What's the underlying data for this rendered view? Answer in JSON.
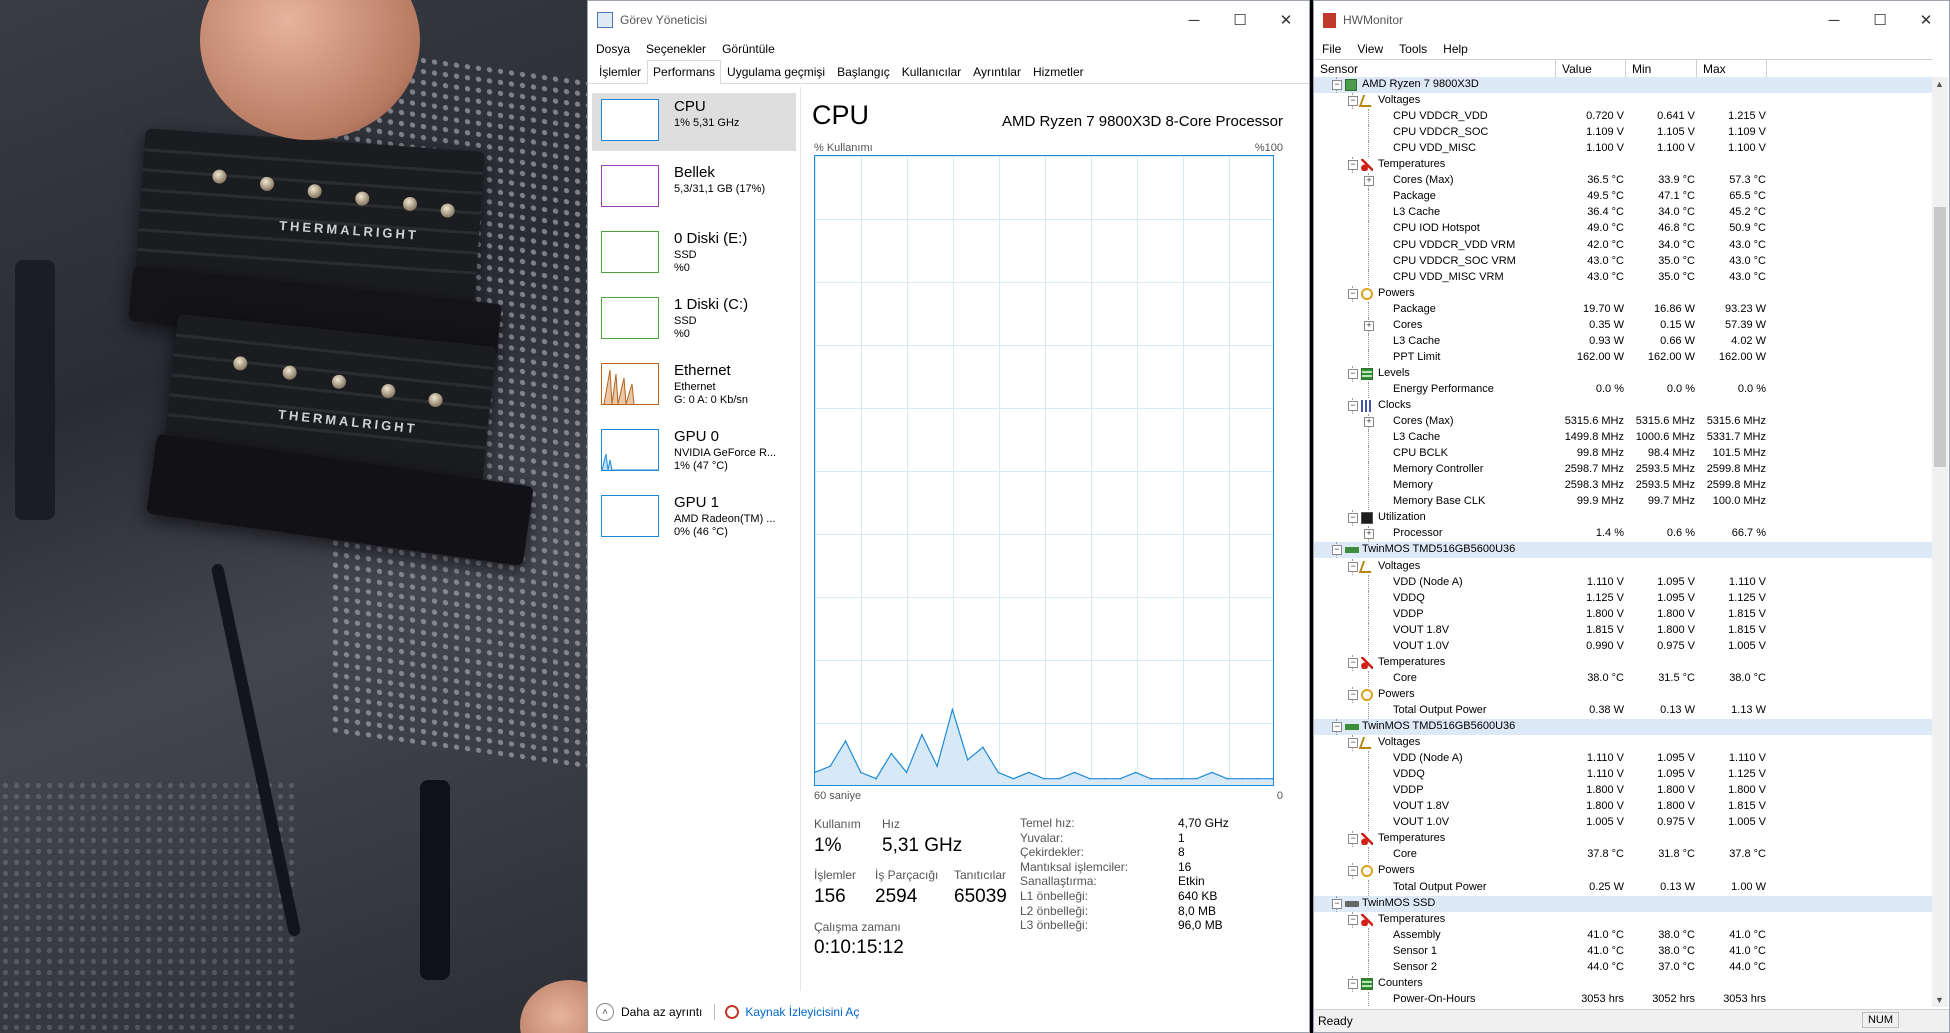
{
  "task_manager": {
    "title": "Görev Yöneticisi",
    "menu": [
      "Dosya",
      "Seçenekler",
      "Görüntüle"
    ],
    "tabs": [
      "İşlemler",
      "Performans",
      "Uygulama geçmişi",
      "Başlangıç",
      "Kullanıcılar",
      "Ayrıntılar",
      "Hizmetler"
    ],
    "active_tab": "Performans",
    "sidebar": [
      {
        "name": "CPU",
        "line1": "1% 5,31 GHz",
        "line2": "",
        "color": "#1e8ad6"
      },
      {
        "name": "Bellek",
        "line1": "5,3/31,1 GB (17%)",
        "line2": "",
        "color": "#9b3fb5"
      },
      {
        "name": "0 Diski (E:)",
        "line1": "SSD",
        "line2": "%0",
        "color": "#4aa63a"
      },
      {
        "name": "1 Diski (C:)",
        "line1": "SSD",
        "line2": "%0",
        "color": "#4aa63a"
      },
      {
        "name": "Ethernet",
        "line1": "Ethernet",
        "line2": "G: 0 A: 0 Kb/sn",
        "color": "#b8621b"
      },
      {
        "name": "GPU 0",
        "line1": "NVIDIA GeForce R...",
        "line2": "1% (47 °C)",
        "color": "#1e8ad6"
      },
      {
        "name": "GPU 1",
        "line1": "AMD Radeon(TM) ...",
        "line2": "0% (46 °C)",
        "color": "#1e8ad6"
      }
    ],
    "main": {
      "heading": "CPU",
      "processor": "AMD Ryzen 7 9800X3D 8-Core Processor",
      "y_label": "% Kullanımı",
      "y_max": "%100",
      "x_left": "60 saniye",
      "x_right": "0",
      "usage_label": "Kullanım",
      "usage_value": "1%",
      "speed_label": "Hız",
      "speed_value": "5,31 GHz",
      "processes_label": "İşlemler",
      "processes_value": "156",
      "threads_label": "İş Parçacığı",
      "threads_value": "2594",
      "handles_label": "Tanıtıcılar",
      "handles_value": "65039",
      "uptime_label": "Çalışma zamanı",
      "uptime_value": "0:10:15:12",
      "specs": [
        {
          "label": "Temel hız:",
          "value": "4,70 GHz"
        },
        {
          "label": "Yuvalar:",
          "value": "1"
        },
        {
          "label": "Çekirdekler:",
          "value": "8"
        },
        {
          "label": "Mantıksal işlemciler:",
          "value": "16"
        },
        {
          "label": "Sanallaştırma:",
          "value": "Etkin"
        },
        {
          "label": "L1 önbelleği:",
          "value": "640 KB"
        },
        {
          "label": "L2 önbelleği:",
          "value": "8,0 MB"
        },
        {
          "label": "L3 önbelleği:",
          "value": "96,0 MB"
        }
      ]
    },
    "footer": {
      "less_details": "Daha az ayrıntı",
      "resource_monitor": "Kaynak İzleyicisini Aç"
    }
  },
  "chart_data": {
    "type": "area",
    "ylabel": "% Kullanımı",
    "ylim": [
      0,
      100
    ],
    "x": [
      60,
      58,
      56,
      54,
      52,
      50,
      48,
      46,
      44,
      42,
      40,
      38,
      36,
      34,
      32,
      30,
      28,
      26,
      24,
      22,
      20,
      18,
      16,
      14,
      12,
      10,
      8,
      6,
      4,
      2,
      0
    ],
    "values": [
      2,
      3,
      7,
      2,
      1,
      5,
      2,
      8,
      3,
      12,
      4,
      6,
      2,
      1,
      2,
      1,
      1,
      2,
      1,
      1,
      1,
      2,
      1,
      1,
      1,
      1,
      2,
      1,
      1,
      1,
      1
    ]
  },
  "hwmonitor": {
    "title": "HWMonitor",
    "menu": [
      "File",
      "View",
      "Tools",
      "Help"
    ],
    "columns": [
      "Sensor",
      "Value",
      "Min",
      "Max"
    ],
    "status": "Ready",
    "num": "NUM",
    "rows": [
      {
        "lvl": 0,
        "icon": "chip-icon",
        "label": "AMD Ryzen 7 9800X3D",
        "v": "",
        "mn": "",
        "mx": "",
        "grp": true,
        "pm": "-"
      },
      {
        "lvl": 1,
        "icon": "voltage-icon",
        "label": "Voltages",
        "v": "",
        "mn": "",
        "mx": "",
        "pm": "-"
      },
      {
        "lvl": 2,
        "label": "CPU VDDCR_VDD",
        "v": "0.720 V",
        "mn": "0.641 V",
        "mx": "1.215 V"
      },
      {
        "lvl": 2,
        "label": "CPU VDDCR_SOC",
        "v": "1.109 V",
        "mn": "1.105 V",
        "mx": "1.109 V"
      },
      {
        "lvl": 2,
        "label": "CPU VDD_MISC",
        "v": "1.100 V",
        "mn": "1.100 V",
        "mx": "1.100 V"
      },
      {
        "lvl": 1,
        "icon": "temperature-icon",
        "label": "Temperatures",
        "v": "",
        "mn": "",
        "mx": "",
        "pm": "-"
      },
      {
        "lvl": 2,
        "label": "Cores (Max)",
        "v": "36.5 °C",
        "mn": "33.9 °C",
        "mx": "57.3 °C",
        "pm": "+"
      },
      {
        "lvl": 2,
        "label": "Package",
        "v": "49.5 °C",
        "mn": "47.1 °C",
        "mx": "65.5 °C"
      },
      {
        "lvl": 2,
        "label": "L3 Cache",
        "v": "36.4 °C",
        "mn": "34.0 °C",
        "mx": "45.2 °C"
      },
      {
        "lvl": 2,
        "label": "CPU IOD Hotspot",
        "v": "49.0 °C",
        "mn": "46.8 °C",
        "mx": "50.9 °C"
      },
      {
        "lvl": 2,
        "label": "CPU VDDCR_VDD VRM",
        "v": "42.0 °C",
        "mn": "34.0 °C",
        "mx": "43.0 °C"
      },
      {
        "lvl": 2,
        "label": "CPU VDDCR_SOC VRM",
        "v": "43.0 °C",
        "mn": "35.0 °C",
        "mx": "43.0 °C"
      },
      {
        "lvl": 2,
        "label": "CPU VDD_MISC VRM",
        "v": "43.0 °C",
        "mn": "35.0 °C",
        "mx": "43.0 °C"
      },
      {
        "lvl": 1,
        "icon": "power-icon",
        "label": "Powers",
        "v": "",
        "mn": "",
        "mx": "",
        "pm": "-"
      },
      {
        "lvl": 2,
        "label": "Package",
        "v": "19.70 W",
        "mn": "16.86 W",
        "mx": "93.23 W"
      },
      {
        "lvl": 2,
        "label": "Cores",
        "v": "0.35 W",
        "mn": "0.15 W",
        "mx": "57.39 W",
        "pm": "+"
      },
      {
        "lvl": 2,
        "label": "L3 Cache",
        "v": "0.93 W",
        "mn": "0.66 W",
        "mx": "4.02 W"
      },
      {
        "lvl": 2,
        "label": "PPT Limit",
        "v": "162.00 W",
        "mn": "162.00 W",
        "mx": "162.00 W"
      },
      {
        "lvl": 1,
        "icon": "levels-icon",
        "label": "Levels",
        "v": "",
        "mn": "",
        "mx": "",
        "pm": "-"
      },
      {
        "lvl": 2,
        "label": "Energy Performance",
        "v": "0.0 %",
        "mn": "0.0 %",
        "mx": "0.0 %"
      },
      {
        "lvl": 1,
        "icon": "clock-icon",
        "label": "Clocks",
        "v": "",
        "mn": "",
        "mx": "",
        "pm": "-"
      },
      {
        "lvl": 2,
        "label": "Cores (Max)",
        "v": "5315.6 MHz",
        "mn": "5315.6 MHz",
        "mx": "5315.6 MHz",
        "pm": "+"
      },
      {
        "lvl": 2,
        "label": "L3 Cache",
        "v": "1499.8 MHz",
        "mn": "1000.6 MHz",
        "mx": "5331.7 MHz"
      },
      {
        "lvl": 2,
        "label": "CPU BCLK",
        "v": "99.8 MHz",
        "mn": "98.4 MHz",
        "mx": "101.5 MHz"
      },
      {
        "lvl": 2,
        "label": "Memory Controller",
        "v": "2598.7 MHz",
        "mn": "2593.5 MHz",
        "mx": "2599.8 MHz"
      },
      {
        "lvl": 2,
        "label": "Memory",
        "v": "2598.3 MHz",
        "mn": "2593.5 MHz",
        "mx": "2599.8 MHz"
      },
      {
        "lvl": 2,
        "label": "Memory Base CLK",
        "v": "99.9 MHz",
        "mn": "99.7 MHz",
        "mx": "100.0 MHz"
      },
      {
        "lvl": 1,
        "icon": "utilization-icon",
        "label": "Utilization",
        "v": "",
        "mn": "",
        "mx": "",
        "pm": "-"
      },
      {
        "lvl": 2,
        "label": "Processor",
        "v": "1.4 %",
        "mn": "0.6 %",
        "mx": "66.7 %",
        "pm": "+"
      },
      {
        "lvl": 0,
        "icon": "ram-icon",
        "label": "TwinMOS TMD516GB5600U36",
        "v": "",
        "mn": "",
        "mx": "",
        "grp": true,
        "pm": "-"
      },
      {
        "lvl": 1,
        "icon": "voltage-icon",
        "label": "Voltages",
        "v": "",
        "mn": "",
        "mx": "",
        "pm": "-"
      },
      {
        "lvl": 2,
        "label": "VDD (Node A)",
        "v": "1.110 V",
        "mn": "1.095 V",
        "mx": "1.110 V"
      },
      {
        "lvl": 2,
        "label": "VDDQ",
        "v": "1.125 V",
        "mn": "1.095 V",
        "mx": "1.125 V"
      },
      {
        "lvl": 2,
        "label": "VDDP",
        "v": "1.800 V",
        "mn": "1.800 V",
        "mx": "1.815 V"
      },
      {
        "lvl": 2,
        "label": "VOUT 1.8V",
        "v": "1.815 V",
        "mn": "1.800 V",
        "mx": "1.815 V"
      },
      {
        "lvl": 2,
        "label": "VOUT 1.0V",
        "v": "0.990 V",
        "mn": "0.975 V",
        "mx": "1.005 V"
      },
      {
        "lvl": 1,
        "icon": "temperature-icon",
        "label": "Temperatures",
        "v": "",
        "mn": "",
        "mx": "",
        "pm": "-"
      },
      {
        "lvl": 2,
        "label": "Core",
        "v": "38.0 °C",
        "mn": "31.5 °C",
        "mx": "38.0 °C"
      },
      {
        "lvl": 1,
        "icon": "power-icon",
        "label": "Powers",
        "v": "",
        "mn": "",
        "mx": "",
        "pm": "-"
      },
      {
        "lvl": 2,
        "label": "Total Output Power",
        "v": "0.38 W",
        "mn": "0.13 W",
        "mx": "1.13 W"
      },
      {
        "lvl": 0,
        "icon": "ram-icon",
        "label": "TwinMOS TMD516GB5600U36",
        "v": "",
        "mn": "",
        "mx": "",
        "grp": true,
        "pm": "-"
      },
      {
        "lvl": 1,
        "icon": "voltage-icon",
        "label": "Voltages",
        "v": "",
        "mn": "",
        "mx": "",
        "pm": "-"
      },
      {
        "lvl": 2,
        "label": "VDD (Node A)",
        "v": "1.110 V",
        "mn": "1.095 V",
        "mx": "1.110 V"
      },
      {
        "lvl": 2,
        "label": "VDDQ",
        "v": "1.110 V",
        "mn": "1.095 V",
        "mx": "1.125 V"
      },
      {
        "lvl": 2,
        "label": "VDDP",
        "v": "1.800 V",
        "mn": "1.800 V",
        "mx": "1.800 V"
      },
      {
        "lvl": 2,
        "label": "VOUT 1.8V",
        "v": "1.800 V",
        "mn": "1.800 V",
        "mx": "1.815 V"
      },
      {
        "lvl": 2,
        "label": "VOUT 1.0V",
        "v": "1.005 V",
        "mn": "0.975 V",
        "mx": "1.005 V"
      },
      {
        "lvl": 1,
        "icon": "temperature-icon",
        "label": "Temperatures",
        "v": "",
        "mn": "",
        "mx": "",
        "pm": "-"
      },
      {
        "lvl": 2,
        "label": "Core",
        "v": "37.8 °C",
        "mn": "31.8 °C",
        "mx": "37.8 °C"
      },
      {
        "lvl": 1,
        "icon": "power-icon",
        "label": "Powers",
        "v": "",
        "mn": "",
        "mx": "",
        "pm": "-"
      },
      {
        "lvl": 2,
        "label": "Total Output Power",
        "v": "0.25 W",
        "mn": "0.13 W",
        "mx": "1.00 W"
      },
      {
        "lvl": 0,
        "icon": "ssd-icon",
        "label": "TwinMOS SSD",
        "v": "",
        "mn": "",
        "mx": "",
        "grp": true,
        "pm": "-"
      },
      {
        "lvl": 1,
        "icon": "temperature-icon",
        "label": "Temperatures",
        "v": "",
        "mn": "",
        "mx": "",
        "pm": "-"
      },
      {
        "lvl": 2,
        "label": "Assembly",
        "v": "41.0 °C",
        "mn": "38.0 °C",
        "mx": "41.0 °C"
      },
      {
        "lvl": 2,
        "label": "Sensor 1",
        "v": "41.0 °C",
        "mn": "38.0 °C",
        "mx": "41.0 °C"
      },
      {
        "lvl": 2,
        "label": "Sensor 2",
        "v": "44.0 °C",
        "mn": "37.0 °C",
        "mx": "44.0 °C"
      },
      {
        "lvl": 1,
        "icon": "counters-icon",
        "label": "Counters",
        "v": "",
        "mn": "",
        "mx": "",
        "pm": "-"
      },
      {
        "lvl": 2,
        "label": "Power-On-Hours",
        "v": "3053 hrs",
        "mn": "3052 hrs",
        "mx": "3053 hrs"
      }
    ]
  },
  "photo": {
    "cooler_brand_top": "THERMALRIGHT",
    "cooler_brand_bottom": "THERMALRIGHT"
  }
}
